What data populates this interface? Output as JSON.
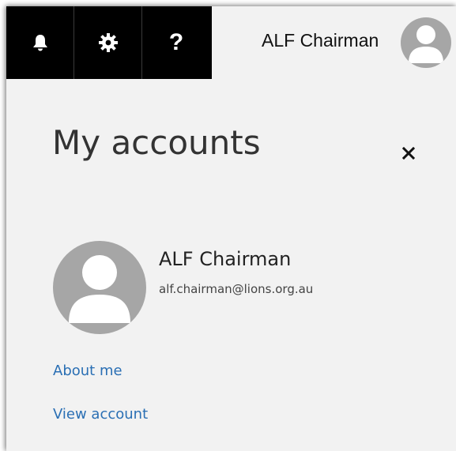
{
  "header": {
    "icons": [
      {
        "name": "bell-icon"
      },
      {
        "name": "gear-icon"
      },
      {
        "name": "help-icon",
        "glyph": "?"
      }
    ],
    "user_name": "ALF Chairman",
    "avatar_icon": "person-icon"
  },
  "panel": {
    "title": "My accounts",
    "close_glyph": "×",
    "account": {
      "name": "ALF Chairman",
      "email": "alf.chairman@lions.org.au",
      "avatar_icon": "person-icon"
    },
    "links": {
      "about_me": "About me",
      "view_account": "View account"
    }
  },
  "colors": {
    "top_bar_icons_bg": "#000000",
    "panel_bg": "#f2f2f2",
    "avatar_bg": "#a6a6a6",
    "link": "#2a6fb4"
  }
}
